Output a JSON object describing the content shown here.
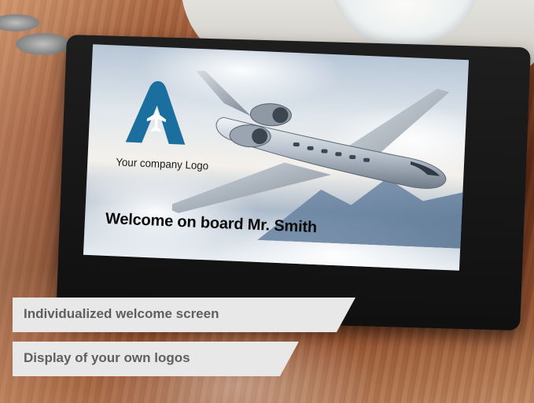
{
  "screen": {
    "logo_caption": "Your company Logo",
    "welcome_message": "Welcome on board Mr. Smith",
    "logo_color": "#1b6f9e"
  },
  "captions": [
    {
      "label": "Individualized welcome screen"
    },
    {
      "label": "Display of your own logos"
    }
  ],
  "icons": {
    "logo": "airplane-icon",
    "photo_subject": "private-jet"
  }
}
